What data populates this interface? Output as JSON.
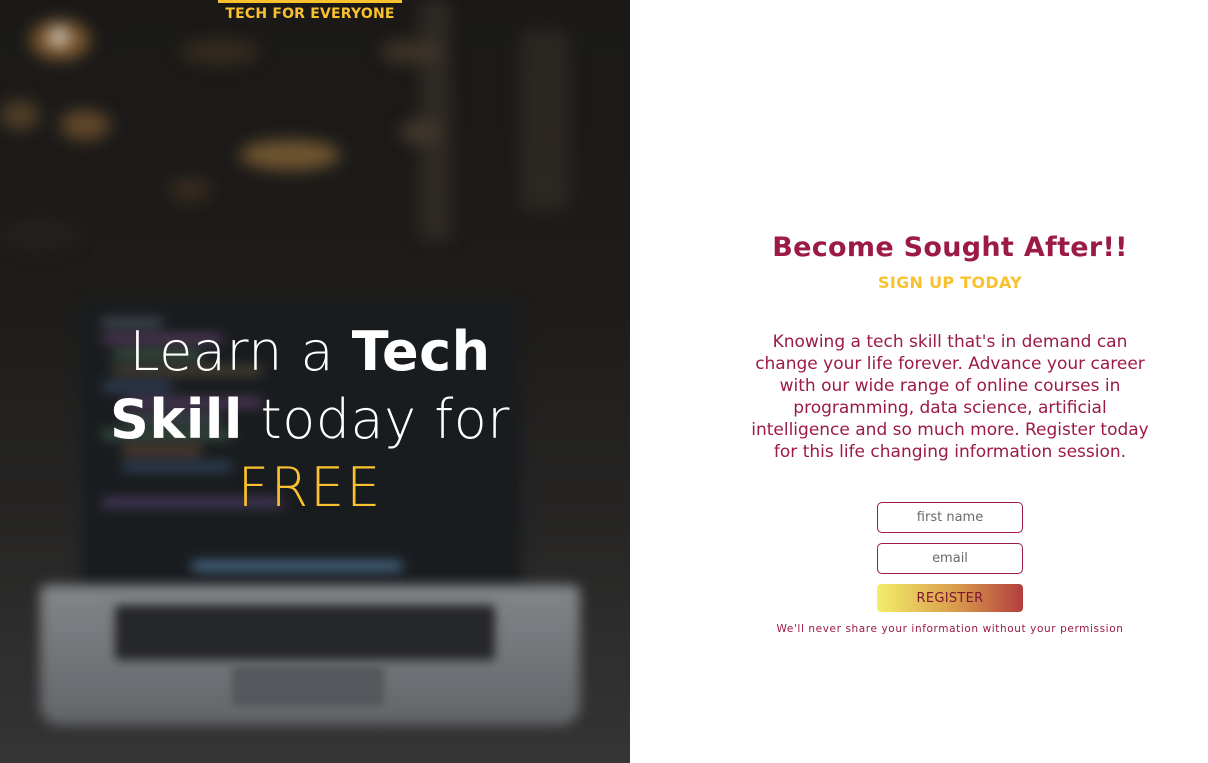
{
  "brand": {
    "tagline": "TECH FOR EVERYONE"
  },
  "hero": {
    "headline_part1": "Learn a ",
    "headline_strong1": "Tech",
    "headline_strong2": "Skill",
    "headline_part2": " today for",
    "headline_accent": "FREE"
  },
  "signup": {
    "title": "Become Sought After!!",
    "subtitle": "SIGN UP TODAY",
    "description": "Knowing a tech skill that's in demand can change your life forever. Advance your career with our wide range of online courses in programming, data science, artificial intelligence and so much more. Register today for this life changing information session.",
    "first_name_placeholder": "first name",
    "email_placeholder": "email",
    "register_label": "REGISTER",
    "privacy_note": "We'll never share your information without your permission"
  },
  "colors": {
    "brand_yellow": "#f9c12e",
    "brand_maroon": "#9c1a47"
  }
}
